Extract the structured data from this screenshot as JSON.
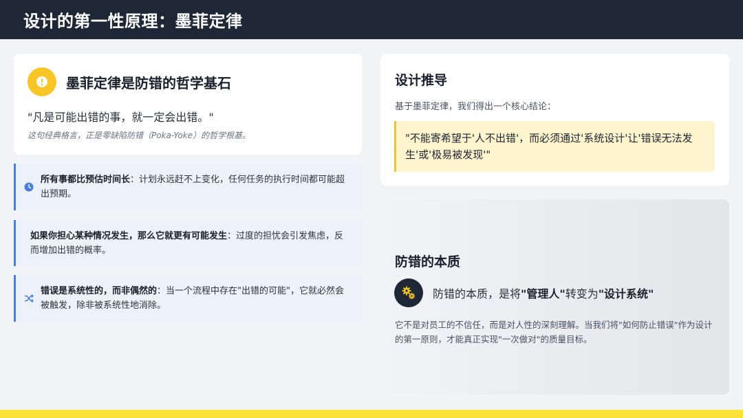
{
  "header": {
    "title": "设计的第一性原理：墨菲定律"
  },
  "murphy": {
    "title": "墨菲定律是防错的哲学基石",
    "quote": "\"凡是可能出错的事，就一定会出错。\"",
    "note": "这句经典格言，正是零缺陷防错（Poka-Yoke）的哲学根基。",
    "icon": "warning-icon"
  },
  "laws": [
    {
      "bold": "所有事都比预估时间长",
      "text": "：计划永远赶不上变化，任何任务的执行时间都可能超出预期。",
      "icon": "clock-icon"
    },
    {
      "bold": "如果你担心某种情况发生，那么它就更有可能发生",
      "text": "：过度的担忧会引发焦虑，反而增加出错的概率。"
    },
    {
      "bold": "错误是系统性的，而非偶然的",
      "text": "：当一个流程中存在\"出错的可能\"，它就必然会被触发，除非被系统性地消除。",
      "icon": "shuffle-icon"
    }
  ],
  "derive": {
    "title": "设计推导",
    "subtitle": "基于墨菲定律，我们得出一个核心结论：",
    "quote": "\"不能寄希望于'人不出错'，而必须通过'系统设计'让'错误无法发生'或'极易被发现'\""
  },
  "essence": {
    "title": "防错的本质",
    "line_prefix": "防错的本质，是将",
    "line_bold1": "\"管理人\"",
    "line_mid": "转变为",
    "line_bold2": "\"设计系统\"",
    "body": "它不是对员工的不信任，而是对人性的深刻理解。当我们将\"如何防止错误\"作为设计的第一原则，才能真正实现\"一次做对\"的质量目标。",
    "icon": "gears-icon"
  },
  "colors": {
    "accent_yellow": "#f7c626",
    "header_bg": "#1d2736",
    "law_border": "#4a7fd6"
  }
}
